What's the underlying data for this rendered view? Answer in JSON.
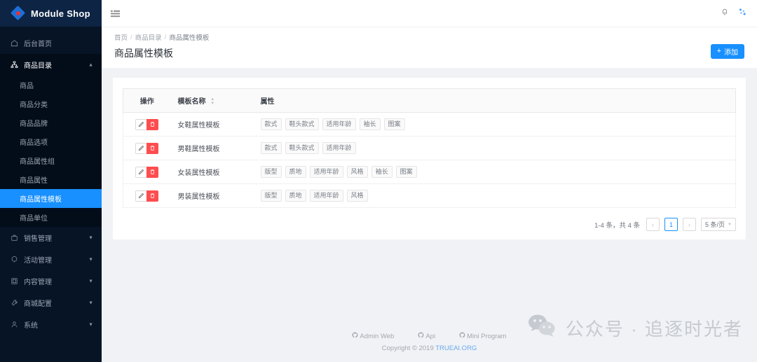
{
  "brand": {
    "name": "Module Shop",
    "logo_icon": "diamond-logo-icon"
  },
  "colors": {
    "sidebar_bg": "#061426",
    "sidebar_submenu_bg": "#030d1a",
    "logo_bar_bg": "#0d2444",
    "accent": "#1890ff",
    "danger": "#ff4d4f",
    "page_bg": "#f0f2f5"
  },
  "sidebar": {
    "items": [
      {
        "label": "后台首页",
        "icon": "home-icon",
        "has_arrow": false,
        "state": "normal"
      },
      {
        "label": "商品目录",
        "icon": "sitemap-icon",
        "has_arrow": true,
        "arrow": "chevron-up-icon",
        "state": "open"
      },
      {
        "label": "销售管理",
        "icon": "briefcase-icon",
        "has_arrow": true,
        "arrow": "chevron-down-icon",
        "state": "normal"
      },
      {
        "label": "活动管理",
        "icon": "tag-icon",
        "has_arrow": true,
        "arrow": "chevron-down-icon",
        "state": "normal"
      },
      {
        "label": "内容管理",
        "icon": "window-icon",
        "has_arrow": true,
        "arrow": "chevron-down-icon",
        "state": "normal"
      },
      {
        "label": "商城配置",
        "icon": "wrench-icon",
        "has_arrow": true,
        "arrow": "chevron-down-icon",
        "state": "normal"
      },
      {
        "label": "系统",
        "icon": "user-icon",
        "has_arrow": true,
        "arrow": "chevron-down-icon",
        "state": "normal"
      }
    ],
    "submenu": [
      {
        "label": "商品",
        "active": false
      },
      {
        "label": "商品分类",
        "active": false
      },
      {
        "label": "商品品牌",
        "active": false
      },
      {
        "label": "商品选项",
        "active": false
      },
      {
        "label": "商品属性组",
        "active": false
      },
      {
        "label": "商品属性",
        "active": false
      },
      {
        "label": "商品属性模板",
        "active": true
      },
      {
        "label": "商品单位",
        "active": false
      }
    ]
  },
  "topbar": {
    "collapse_icon": "menu-fold-icon",
    "bell_icon": "bell-icon",
    "apps_icon": "sparkle-icon"
  },
  "page": {
    "breadcrumb": [
      "首页",
      "商品目录",
      "商品属性模板"
    ],
    "breadcrumb_separator": "/",
    "title": "商品属性模板",
    "add_button": {
      "label": "添加",
      "icon": "plus-icon"
    }
  },
  "table": {
    "columns": [
      {
        "label": "操作",
        "sortable": false
      },
      {
        "label": "模板名称",
        "sortable": true,
        "sort_icon": "caret-updown-icon"
      },
      {
        "label": "属性",
        "sortable": false
      }
    ],
    "row_actions": [
      {
        "name": "edit",
        "icon": "pencil-icon"
      },
      {
        "name": "delete",
        "icon": "trash-icon"
      }
    ],
    "rows": [
      {
        "name": "女鞋属性模板",
        "tags": [
          "款式",
          "鞋头款式",
          "适用年龄",
          "袖长",
          "图案"
        ]
      },
      {
        "name": "男鞋属性模板",
        "tags": [
          "款式",
          "鞋头款式",
          "适用年龄"
        ]
      },
      {
        "name": "女装属性模板",
        "tags": [
          "版型",
          "质地",
          "适用年龄",
          "风格",
          "袖长",
          "图案"
        ]
      },
      {
        "name": "男装属性模板",
        "tags": [
          "版型",
          "质地",
          "适用年龄",
          "风格"
        ]
      }
    ]
  },
  "pagination": {
    "total_text": "1-4 条，共 4 条",
    "prev_icon": "chevron-left-icon",
    "next_icon": "chevron-right-icon",
    "current_page": "1",
    "page_size_label": "5 条/页",
    "page_size_caret": "chevron-down-icon"
  },
  "footer": {
    "links": [
      {
        "label": "Admin Web",
        "icon": "github-icon"
      },
      {
        "label": "Api",
        "icon": "github-icon"
      },
      {
        "label": "Mini Program",
        "icon": "github-icon"
      }
    ],
    "copyright_prefix": "Copyright © 2019 ",
    "copyright_brand": "TRUEAI.ORG"
  },
  "watermark": {
    "icon": "wechat-icon",
    "text": "公众号 · 追逐时光者"
  }
}
